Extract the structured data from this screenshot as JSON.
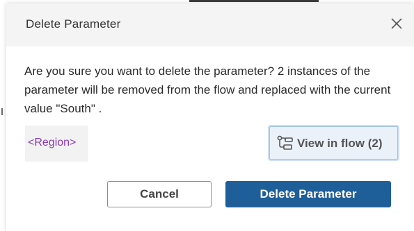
{
  "dialog": {
    "title": "Delete Parameter",
    "close_icon": "close-icon",
    "message": "Are you sure you want to delete the parameter? 2 instances of the parameter will be removed from the flow and replaced with the current value \"South\" .",
    "parameter_label": "<Region>",
    "view_in_flow": {
      "icon": "flow-icon",
      "label": "View in flow (2)"
    },
    "buttons": {
      "cancel_label": "Cancel",
      "delete_label": "Delete Parameter"
    }
  },
  "colors": {
    "header_bg": "#f4f4f4",
    "accent": "#1f5f99",
    "parameter_link": "#8a3ab9",
    "view_button_bg": "#eaf1f9"
  }
}
